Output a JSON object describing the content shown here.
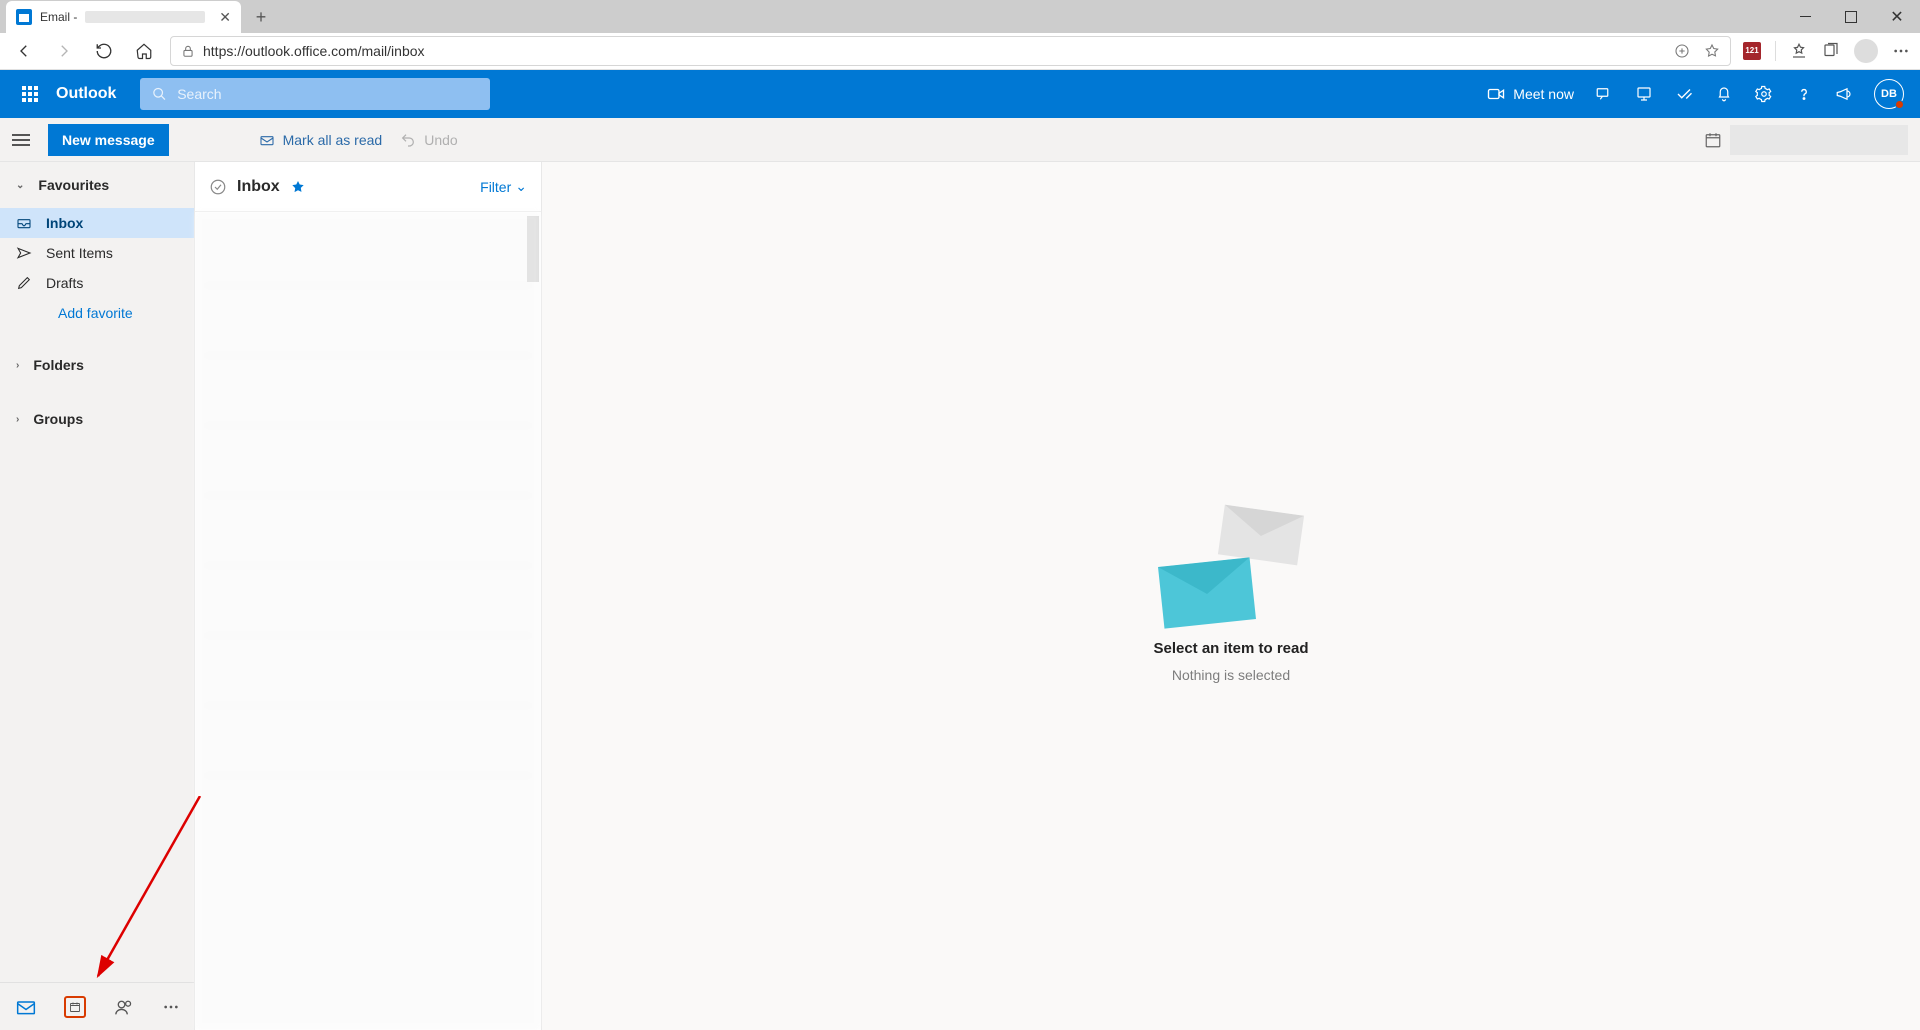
{
  "browser": {
    "tab_prefix": "Email -",
    "url": "https://outlook.office.com/mail/inbox",
    "calendar_badge": "121"
  },
  "header": {
    "brand": "Outlook",
    "search_placeholder": "Search",
    "meet_now": "Meet now",
    "avatar_initials": "DB"
  },
  "cmdbar": {
    "new_message": "New message",
    "mark_all_read": "Mark all as read",
    "undo": "Undo"
  },
  "sidebar": {
    "favourites": "Favourites",
    "items": [
      {
        "label": "Inbox"
      },
      {
        "label": "Sent Items"
      },
      {
        "label": "Drafts"
      }
    ],
    "add_favorite": "Add favorite",
    "folders": "Folders",
    "groups": "Groups"
  },
  "list": {
    "title": "Inbox",
    "filter": "Filter"
  },
  "reading": {
    "title": "Select an item to read",
    "subtitle": "Nothing is selected"
  }
}
